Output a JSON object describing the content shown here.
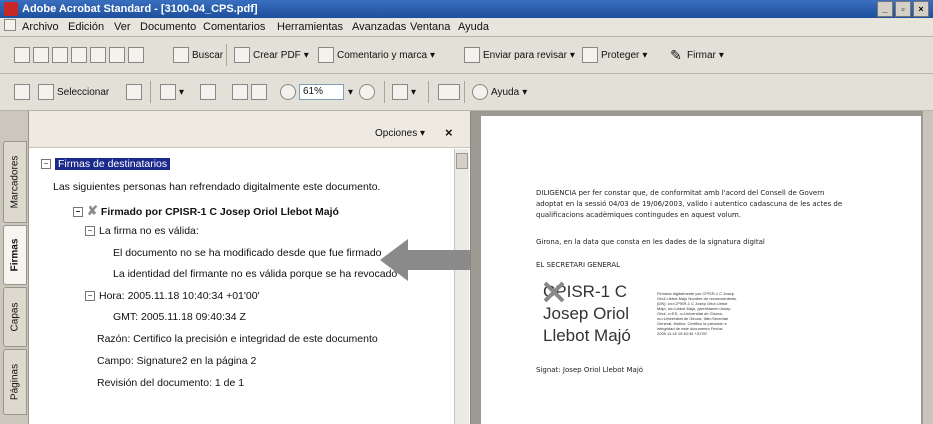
{
  "window": {
    "title": "Adobe Acrobat Standard - [3100-04_CPS.pdf]"
  },
  "menu": [
    "Archivo",
    "Edición",
    "Ver",
    "Documento",
    "Comentarios",
    "Herramientas",
    "Avanzadas",
    "Ventana",
    "Ayuda"
  ],
  "toolbar1": {
    "buscar": "Buscar",
    "crear_pdf": "Crear PDF",
    "comentario": "Comentario y marca",
    "enviar": "Enviar para revisar",
    "proteger": "Proteger",
    "firmar": "Firmar"
  },
  "toolbar2": {
    "seleccionar": "Seleccionar",
    "zoom": "61%",
    "ayuda": "Ayuda"
  },
  "side_tabs": [
    "Marcadores",
    "Firmas",
    "Capas",
    "Páginas"
  ],
  "panel": {
    "options": "Opciones",
    "root": "Firmas de destinatarios",
    "intro": "Las siguientes personas han refrendado digitalmente este documento.",
    "signed_by": "Firmado por CPISR-1 C Josep Oriol Llebot Majó",
    "invalid": "La firma no es válida:",
    "not_modified": "El documento no se ha modificado desde que fue firmado",
    "revoked": "La identidad del firmante no es válida porque se ha revocado",
    "hora": "Hora: 2005.11.18 10:40:34 +01'00'",
    "gmt": "GMT: 2005.11.18 09:40:34 Z",
    "razon": "Razón: Certifico la precisión e integridad de este documento",
    "campo": "Campo: Signature2 en la página 2",
    "revision": "Revisión del documento: 1 de 1"
  },
  "document": {
    "diligencia": [
      "DILIGÈNCIA per fer constar que, de conformitat amb l'acord del Consell de Govern",
      "adoptat en la sessió 04/03 de 19/06/2003, valido i autentico cadascuna de les actes de",
      "qualificacions acadèmiques contingudes en aquest volum."
    ],
    "girona": "Girona, en la data que consta en les dades de la signatura digital",
    "secretari": "EL SECRETARI GENERAL",
    "sig_lines": [
      "CPISR-1 C",
      "Josep Oriol",
      "Llebot Majó"
    ],
    "sig_details": "Firmado digitalmente por CPISR-1 C Josep Oriol Llebot Majó Nombre de reconocimiento (DN): cn=CPISR-1 C Josep Oriol Llebot Majó, sn=Llebot Majó, givenName=Josep Oriol, c=ES, o=Universitat de Girona, ou=Universitat de Girona, title=Secretari General, Motivo: Certifico la precisión e integridad de este documento Fecha: 2005.11.18 10:40:34 +01'00'",
    "signat": "Signat: Josep Oriol Llebot Majó"
  }
}
